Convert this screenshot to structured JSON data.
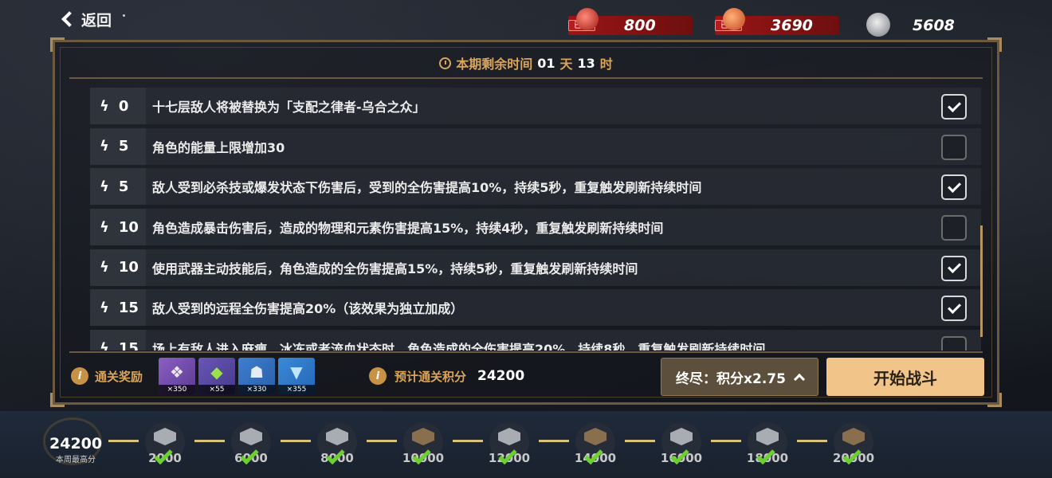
{
  "header": {
    "back_label": "返回",
    "resources": [
      {
        "tag": "已满",
        "value": "800",
        "color": "#9a1515"
      },
      {
        "tag": "已满",
        "value": "3690",
        "color": "#9a1515"
      },
      {
        "tag": "",
        "value": "5608",
        "color": "#22262e"
      }
    ]
  },
  "timer": {
    "prefix": "本期剩余时间",
    "days": "01",
    "day_unit": "天",
    "hours": "13",
    "hour_unit": "时"
  },
  "modifiers": [
    {
      "cost": "0",
      "text": "十七层敌人将被替换为「支配之律者-乌合之众」",
      "checked": true
    },
    {
      "cost": "5",
      "text": "角色的能量上限增加30",
      "checked": false
    },
    {
      "cost": "5",
      "text": "敌人受到必杀技或爆发状态下伤害后，受到的全伤害提高10%，持续5秒，重复触发刷新持续时间",
      "checked": true
    },
    {
      "cost": "10",
      "text": "角色造成暴击伤害后，造成的物理和元素伤害提高15%，持续4秒，重复触发刷新持续时间",
      "checked": false
    },
    {
      "cost": "10",
      "text": "使用武器主动技能后，角色造成的全伤害提高15%，持续5秒，重复触发刷新持续时间",
      "checked": true
    },
    {
      "cost": "15",
      "text": "敌人受到的远程全伤害提高20%（该效果为独立加成）",
      "checked": true
    },
    {
      "cost": "15",
      "text": "场上有敌人进入麻痹、冰冻或者流血状态时，角色造成的全伤害提高20%，持续8秒，重复触发刷新持续时间",
      "checked": false
    }
  ],
  "rewards": {
    "label": "通关奖励",
    "items": [
      {
        "icon": "character-crystal-icon",
        "count": "×350"
      },
      {
        "icon": "green-gem-icon",
        "count": "×55"
      },
      {
        "icon": "hooded-figure-icon",
        "count": "×330"
      },
      {
        "icon": "blue-crest-icon",
        "count": "×355"
      }
    ]
  },
  "estimate": {
    "label": "预计通关积分",
    "value": "24200"
  },
  "difficulty_label": "终尽：积分x2.75",
  "start_label": "开始战斗",
  "track": {
    "best_score": "24200",
    "best_label": "本周最高分",
    "nodes": [
      {
        "threshold": "2000",
        "tier": "silver"
      },
      {
        "threshold": "6000",
        "tier": "silver"
      },
      {
        "threshold": "8000",
        "tier": "silver"
      },
      {
        "threshold": "10000",
        "tier": "bronze"
      },
      {
        "threshold": "12000",
        "tier": "silver"
      },
      {
        "threshold": "14000",
        "tier": "bronze"
      },
      {
        "threshold": "16000",
        "tier": "silver"
      },
      {
        "threshold": "18000",
        "tier": "silver"
      },
      {
        "threshold": "20000",
        "tier": "bronze"
      }
    ]
  }
}
